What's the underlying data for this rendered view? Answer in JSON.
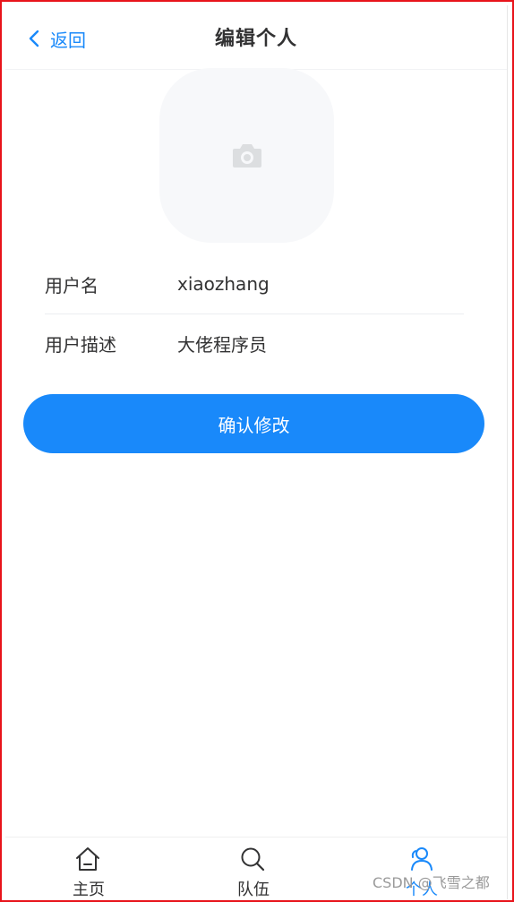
{
  "nav": {
    "back_label": "返回",
    "title": "编辑个人"
  },
  "avatar": {
    "icon": "camera-icon"
  },
  "form": {
    "fields": [
      {
        "label": "用户名",
        "value": "xiaozhang"
      },
      {
        "label": "用户描述",
        "value": "大佬程序员"
      }
    ]
  },
  "submit_label": "确认修改",
  "tabbar": {
    "tabs": [
      {
        "label": "主页",
        "icon": "home-icon"
      },
      {
        "label": "队伍",
        "icon": "search-icon"
      },
      {
        "label": "个人",
        "icon": "user-icon",
        "active": true
      }
    ]
  },
  "watermark": "CSDN @飞雪之都",
  "colors": {
    "accent": "#1989fa",
    "text": "#323233",
    "placeholder_bg": "#f7f8fa",
    "frame": "#e8141b"
  }
}
